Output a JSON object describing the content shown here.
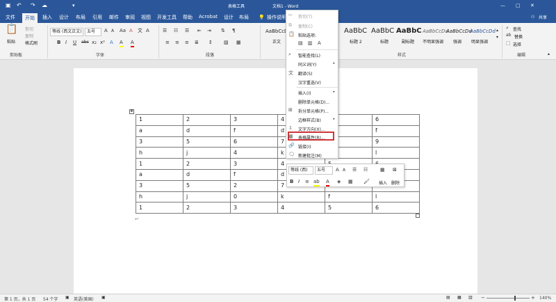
{
  "title": {
    "tool_tab": "表格工具",
    "doc_title": "文档1 - Word",
    "share": "共享",
    "search_hint": "操作说明"
  },
  "menu": [
    "文件",
    "开始",
    "插入",
    "设计",
    "布局",
    "引用",
    "邮件",
    "审阅",
    "视图",
    "开发工具",
    "帮助",
    "Acrobat",
    "设计",
    "布局"
  ],
  "ribbon": {
    "clipboard": {
      "paste": "粘贴",
      "cut": "剪切",
      "copy": "复制",
      "format_painter": "格式刷",
      "group": "剪贴板"
    },
    "font": {
      "name": "等线 (西文正文)",
      "size": "五号",
      "group": "字体",
      "buttons": [
        "B",
        "I",
        "U",
        "abc",
        "x₂",
        "x²",
        "A",
        "A",
        "A"
      ]
    },
    "paragraph": {
      "group": "段落"
    },
    "styles": {
      "group": "样式",
      "items": [
        "AaBbCcDc",
        "AaBbC",
        "AaBbC",
        "AaBbC",
        "AaBbCcDd",
        "AaBbCcDd",
        "AaBbCcDd"
      ],
      "labels": [
        "正文",
        "标题 2",
        "标题",
        "副标题",
        "不明显强调",
        "强调",
        "明显强调"
      ]
    },
    "editing": {
      "find": "查找",
      "replace": "替换",
      "select": "选择",
      "group": "编辑"
    }
  },
  "table": [
    [
      "1",
      "2",
      "3",
      "4",
      "5",
      "6"
    ],
    [
      "a",
      "d",
      "f",
      "d",
      "",
      "f"
    ],
    [
      "3",
      "5",
      "6",
      "7",
      "",
      "9"
    ],
    [
      "h",
      "j",
      "4",
      "k",
      "",
      "l"
    ],
    [
      "1",
      "2",
      "3",
      "4",
      "5",
      "6"
    ],
    [
      "a",
      "d",
      "f",
      "d",
      "f",
      "f"
    ],
    [
      "3",
      "5",
      "2",
      "7",
      "8",
      "9"
    ],
    [
      "h",
      "j",
      "0",
      "k",
      "f",
      "l"
    ],
    [
      "1",
      "2",
      "3",
      "4",
      "5",
      "6"
    ]
  ],
  "context_menu": {
    "cut": "剪切(T)",
    "copy": "复制(C)",
    "paste_options": "粘贴选项:",
    "smart_lookup": "智能查找(L)",
    "synonyms": "同义词(Y)",
    "translate": "翻译(S)",
    "hanzi": "汉字重选(V)",
    "insert": "插入(I)",
    "delete_cells": "删除单元格(D)...",
    "split_cells": "拆分单元格(P)...",
    "border_styles": "边框样式(B)",
    "text_direction": "文字方向(X)...",
    "table_properties": "表格属性(R)...",
    "link": "链接(I)",
    "new_comment": "新建批注(M)"
  },
  "mini_toolbar": {
    "font": "等线 (西)",
    "size": "五号",
    "insert": "插入",
    "delete": "删除"
  },
  "status": {
    "page": "第 1 页，共 1 页",
    "words": "54 个字",
    "lang": "英语(美国)",
    "zoom": "140%"
  },
  "colors": {
    "brand": "#2b579a",
    "highlight": "#d13438"
  }
}
